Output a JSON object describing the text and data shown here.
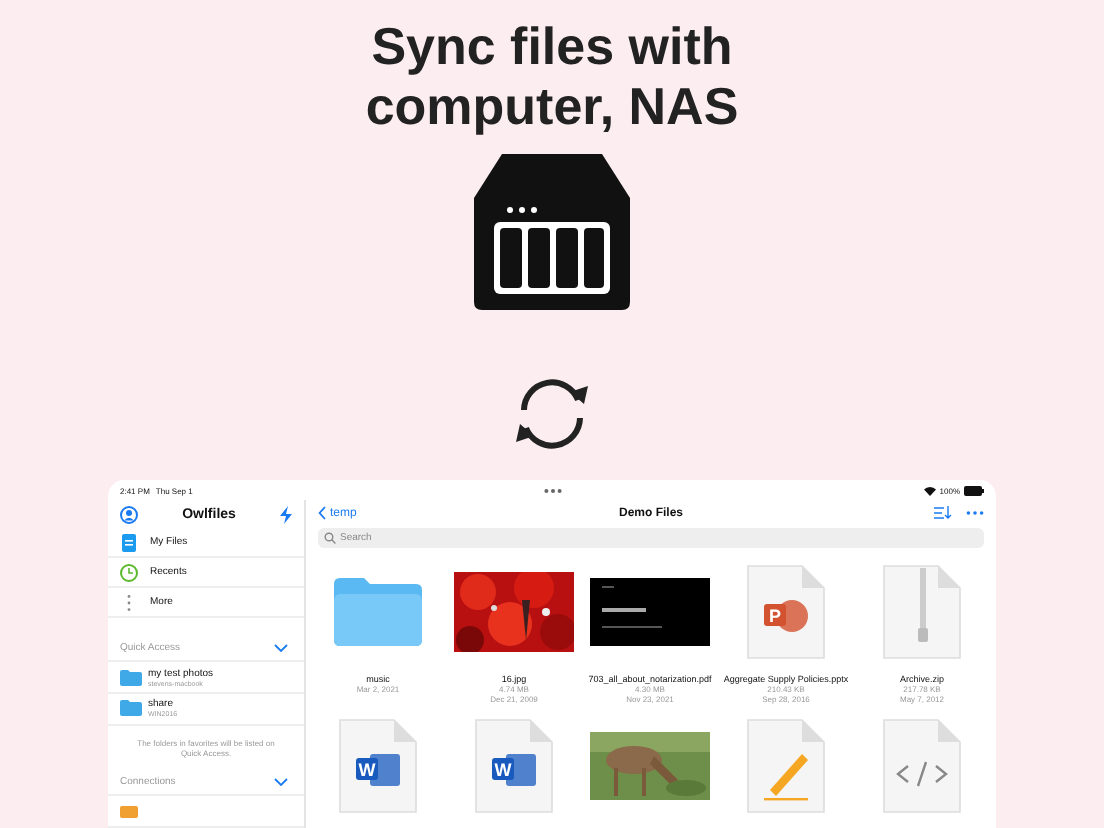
{
  "headline_lines": [
    "Sync files with",
    "computer, NAS"
  ],
  "status_bar": {
    "time": "2:41 PM",
    "date": "Thu Sep 1",
    "battery": "100%"
  },
  "sidebar": {
    "title": "Owlfiles",
    "items": [
      {
        "label": "My Files",
        "kind": "files"
      },
      {
        "label": "Recents",
        "kind": "recents"
      },
      {
        "label": "More",
        "kind": "more"
      }
    ],
    "quick_access": {
      "title": "Quick Access",
      "expanded": true,
      "items": [
        {
          "name": "my test photos",
          "host": "stevens-macbook"
        },
        {
          "name": "share",
          "host": "WIN2016"
        }
      ],
      "note": "The folders in favorites will be listed on Quick Access."
    },
    "connections": {
      "title": "Connections",
      "expanded": true
    }
  },
  "main": {
    "back": "temp",
    "title": "Demo Files",
    "search": {
      "placeholder": "Search"
    },
    "files": [
      {
        "kind": "folder",
        "name": "music",
        "details": [
          "Mar 2, 2021"
        ]
      },
      {
        "name": "16.jpg",
        "details": [
          "4.74 MB",
          "Dec 21, 2009"
        ]
      },
      {
        "kind": "slide",
        "name": "703_all_about_notarization.pdf",
        "details": [
          "4.30 MB",
          "Nov 23, 2021"
        ]
      },
      {
        "kind": "office",
        "badge": "P",
        "name": "Aggregate Supply Policies.pptx",
        "details": [
          "210.43 KB",
          "Sep 28, 2016"
        ]
      },
      {
        "kind": "zip",
        "name": "Archive.zip",
        "details": [
          "217.78 KB",
          "May 7, 2012"
        ]
      },
      {
        "kind": "office",
        "badge": "W"
      },
      {
        "kind": "office",
        "badge": "W"
      },
      {
        "kind": "photo2"
      },
      {
        "kind": "pen"
      },
      {
        "kind": "code"
      }
    ]
  }
}
